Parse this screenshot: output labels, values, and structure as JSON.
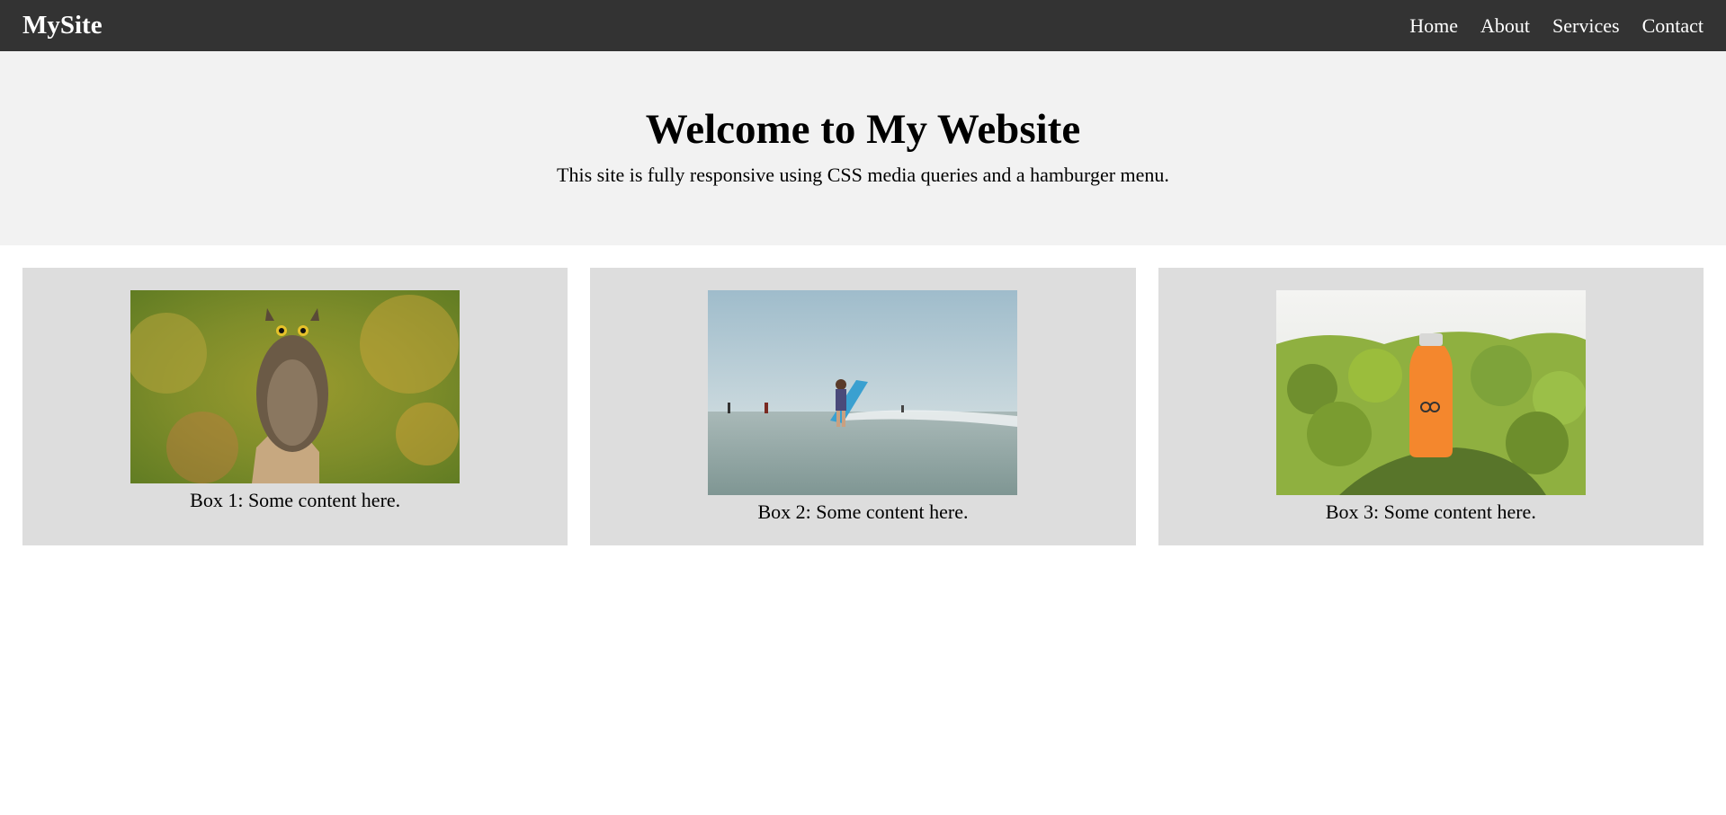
{
  "navbar": {
    "brand": "MySite",
    "links": [
      "Home",
      "About",
      "Services",
      "Contact"
    ]
  },
  "hero": {
    "title": "Welcome to My Website",
    "subtitle": "This site is fully responsive using CSS media queries and a hamburger menu."
  },
  "boxes": [
    {
      "text": "Box 1: Some content here.",
      "image": "owl-photo"
    },
    {
      "text": "Box 2: Some content here.",
      "image": "beach-boy-surfboard-photo"
    },
    {
      "text": "Box 3: Some content here.",
      "image": "orange-bottle-on-moss-photo"
    }
  ]
}
